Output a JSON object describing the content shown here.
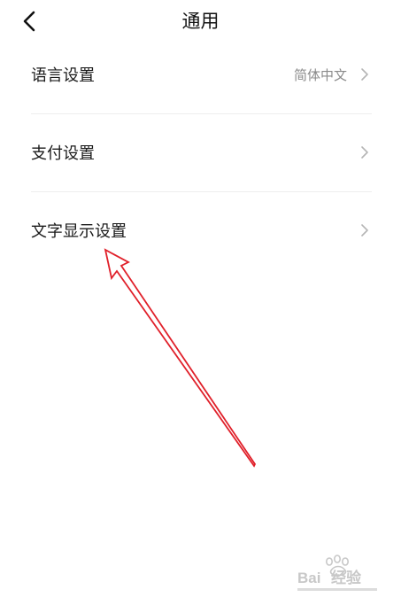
{
  "header": {
    "title": "通用",
    "back_icon": "chevron-left-icon"
  },
  "settings": {
    "items": [
      {
        "label": "语言设置",
        "value": "简体中文",
        "icon": "chevron-right-icon"
      },
      {
        "label": "支付设置",
        "value": "",
        "icon": "chevron-right-icon"
      },
      {
        "label": "文字显示设置",
        "value": "",
        "icon": "chevron-right-icon"
      }
    ]
  },
  "annotation": {
    "type": "red-arrow",
    "color": "#e0202a",
    "points_to": "文字显示设置"
  },
  "watermark": {
    "brand": "Baidu经验"
  },
  "colors": {
    "background": "#ffffff",
    "text_primary": "#1a1a1a",
    "text_secondary": "#8a8a8a",
    "divider": "#eeeeee",
    "chevron": "#b5b5b5"
  }
}
